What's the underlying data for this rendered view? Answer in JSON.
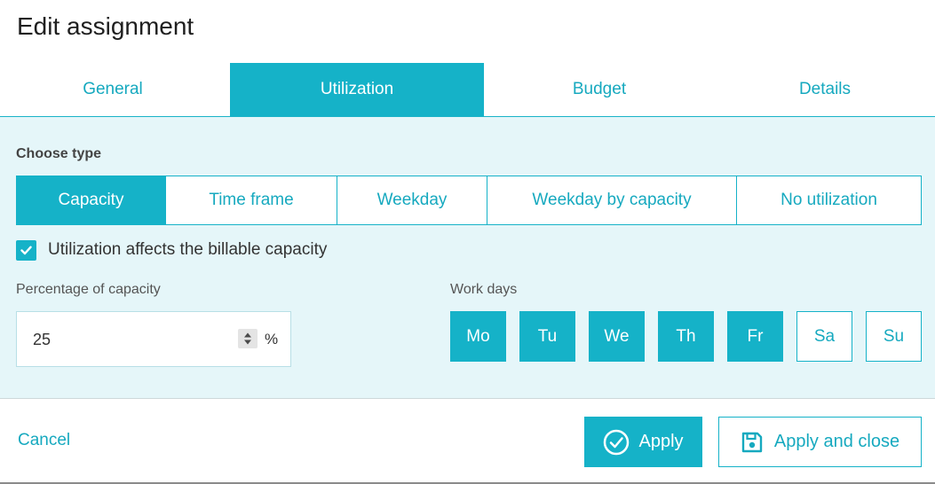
{
  "dialog": {
    "title": "Edit assignment"
  },
  "tabs": [
    {
      "label": "General",
      "active": false
    },
    {
      "label": "Utilization",
      "active": true
    },
    {
      "label": "Budget",
      "active": false
    },
    {
      "label": "Details",
      "active": false
    }
  ],
  "utilization": {
    "choose_type_label": "Choose type",
    "types": [
      {
        "label": "Capacity",
        "selected": true
      },
      {
        "label": "Time frame",
        "selected": false
      },
      {
        "label": "Weekday",
        "selected": false
      },
      {
        "label": "Weekday by capacity",
        "selected": false
      },
      {
        "label": "No utilization",
        "selected": false
      }
    ],
    "billable_checkbox": {
      "label": "Utilization affects the billable capacity",
      "checked": true
    },
    "percentage": {
      "label": "Percentage of capacity",
      "value": "25",
      "unit": "%"
    },
    "work_days": {
      "label": "Work days",
      "days": [
        {
          "label": "Mo",
          "selected": true
        },
        {
          "label": "Tu",
          "selected": true
        },
        {
          "label": "We",
          "selected": true
        },
        {
          "label": "Th",
          "selected": true
        },
        {
          "label": "Fr",
          "selected": true
        },
        {
          "label": "Sa",
          "selected": false
        },
        {
          "label": "Su",
          "selected": false
        }
      ]
    }
  },
  "footer": {
    "cancel_label": "Cancel",
    "apply_label": "Apply",
    "apply_close_label": "Apply and close"
  },
  "colors": {
    "accent": "#15b2c8",
    "panel_bg": "#e5f6f9",
    "accent_text": "#16a9bf"
  },
  "icons": {
    "apply": "check-circle-icon",
    "apply_close": "floppy-disk-icon",
    "checkbox": "checkmark-icon",
    "spinner": "spinner-arrows-icon"
  }
}
